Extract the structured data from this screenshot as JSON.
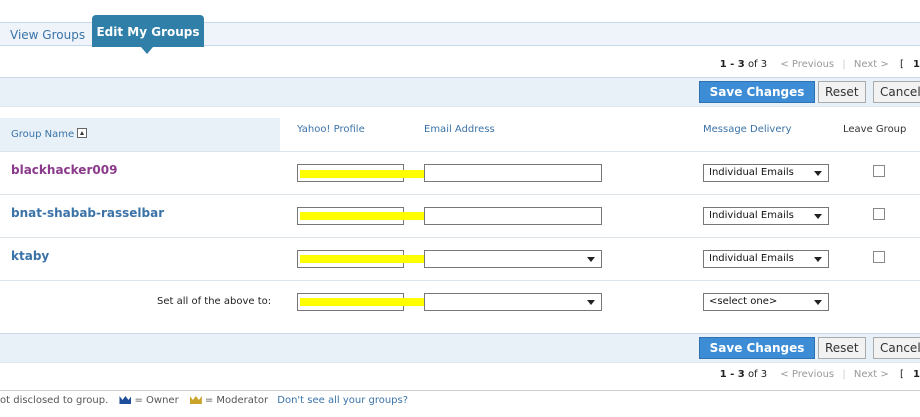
{
  "tabs": {
    "view": "View Groups",
    "edit": "Edit My Groups"
  },
  "pager": {
    "range": "1 - 3",
    "of": "of 3",
    "previous": "< Previous",
    "next": "Next >",
    "bracket": "[",
    "page": "1"
  },
  "actions": {
    "save": "Save Changes",
    "reset": "Reset",
    "cancel": "Cancel"
  },
  "columns": {
    "group_name": "Group Name",
    "yahoo_profile": "Yahoo! Profile",
    "email": "Email Address",
    "delivery": "Message Delivery",
    "leave": "Leave Group"
  },
  "rows": [
    {
      "name": "blackhacker009",
      "delivery": "Individual Emails"
    },
    {
      "name": "bnat-shabab-rasselbar",
      "delivery": "Individual Emails"
    },
    {
      "name": "ktaby",
      "delivery": "Individual Emails"
    }
  ],
  "set_all": {
    "label": "Set all of the above to:",
    "delivery": "<select one>"
  },
  "footer": {
    "not_disclosed": "ot disclosed to group.",
    "owner": "= Owner",
    "moderator": "= Moderator",
    "link": "Don't see all your groups?"
  },
  "colors": {
    "tab_active": "#2f7fa8",
    "save_button": "#3d8dd6",
    "link": "#3b73a8",
    "highlight": "#ffff00"
  }
}
